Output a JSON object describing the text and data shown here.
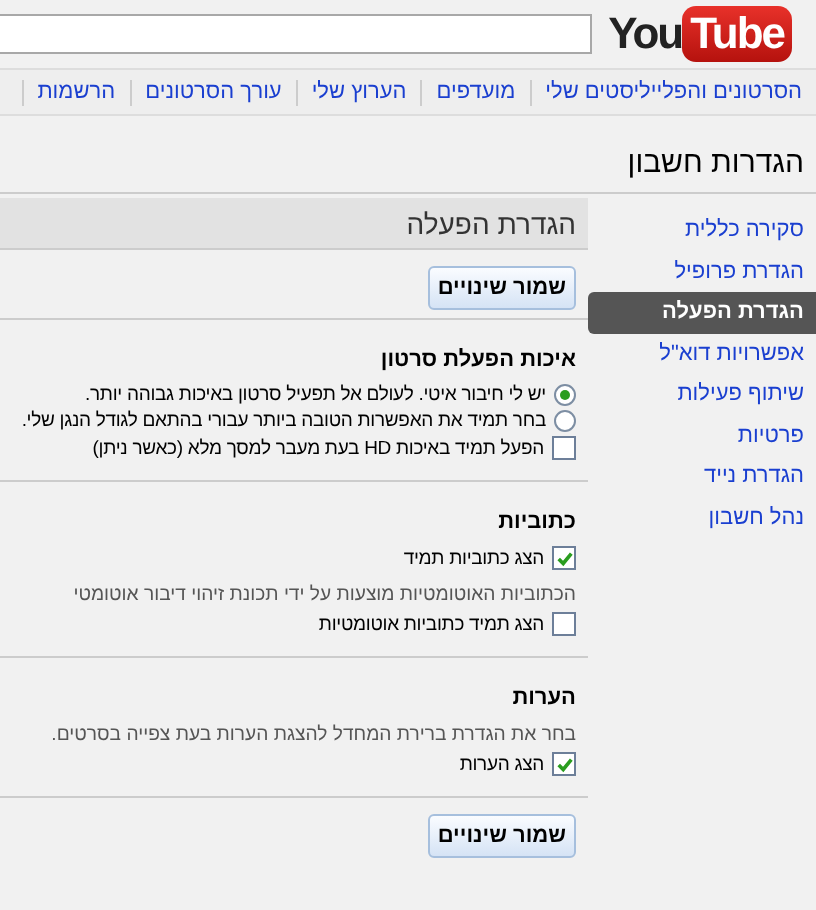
{
  "logo": {
    "first": "You",
    "second": "Tube"
  },
  "nav": [
    "הסרטונים והפלייליסטים שלי",
    "מועדפים",
    "הערוץ שלי",
    "עורך הסרטונים",
    "הרשמות"
  ],
  "page_title": "הגדרות חשבון",
  "sidebar": {
    "items": [
      {
        "label": "סקירה כללית",
        "selected": false
      },
      {
        "label": "הגדרת פרופיל",
        "selected": false
      },
      {
        "label": "הגדרת הפעלה",
        "selected": true
      },
      {
        "label": "אפשרויות דוא\"ל",
        "selected": false
      },
      {
        "label": "שיתוף פעילות",
        "selected": false
      },
      {
        "label": "פרטיות",
        "selected": false
      },
      {
        "label": "הגדרת נייד",
        "selected": false
      },
      {
        "label": "נהל חשבון",
        "selected": false
      }
    ]
  },
  "panel": {
    "title": "הגדרת הפעלה",
    "save_button": "שמור שינויים"
  },
  "sections": [
    {
      "title": "איכות הפעלת סרטון",
      "items": [
        {
          "kind": "radio",
          "label": "יש לי חיבור איטי. לעולם אל תפעיל סרטון באיכות גבוהה יותר.",
          "selected": true
        },
        {
          "kind": "radio",
          "label": "בחר תמיד את האפשרות הטובה ביותר עבורי בהתאם לגודל הנגן שלי.",
          "selected": false
        },
        {
          "kind": "checkbox",
          "label": "הפעל תמיד באיכות HD בעת מעבר למסך מלא (כאשר ניתן)",
          "checked": false
        }
      ]
    },
    {
      "title": "כתוביות",
      "items": [
        {
          "kind": "checkbox",
          "label": "הצג כתוביות תמיד",
          "checked": true
        },
        {
          "kind": "note",
          "label": "הכתוביות האוטומטיות מוצעות על ידי תכונת זיהוי דיבור אוטומטי"
        },
        {
          "kind": "checkbox",
          "label": "הצג תמיד כתוביות אוטומטיות",
          "checked": false
        }
      ]
    },
    {
      "title": "הערות",
      "items": [
        {
          "kind": "note",
          "label": "בחר את הגדרת ברירת המחדל להצגת הערות בעת צפייה בסרטים."
        },
        {
          "kind": "checkbox",
          "label": "הצג הערות",
          "checked": true
        }
      ]
    }
  ],
  "bottom_button": "שמור שינויים"
}
